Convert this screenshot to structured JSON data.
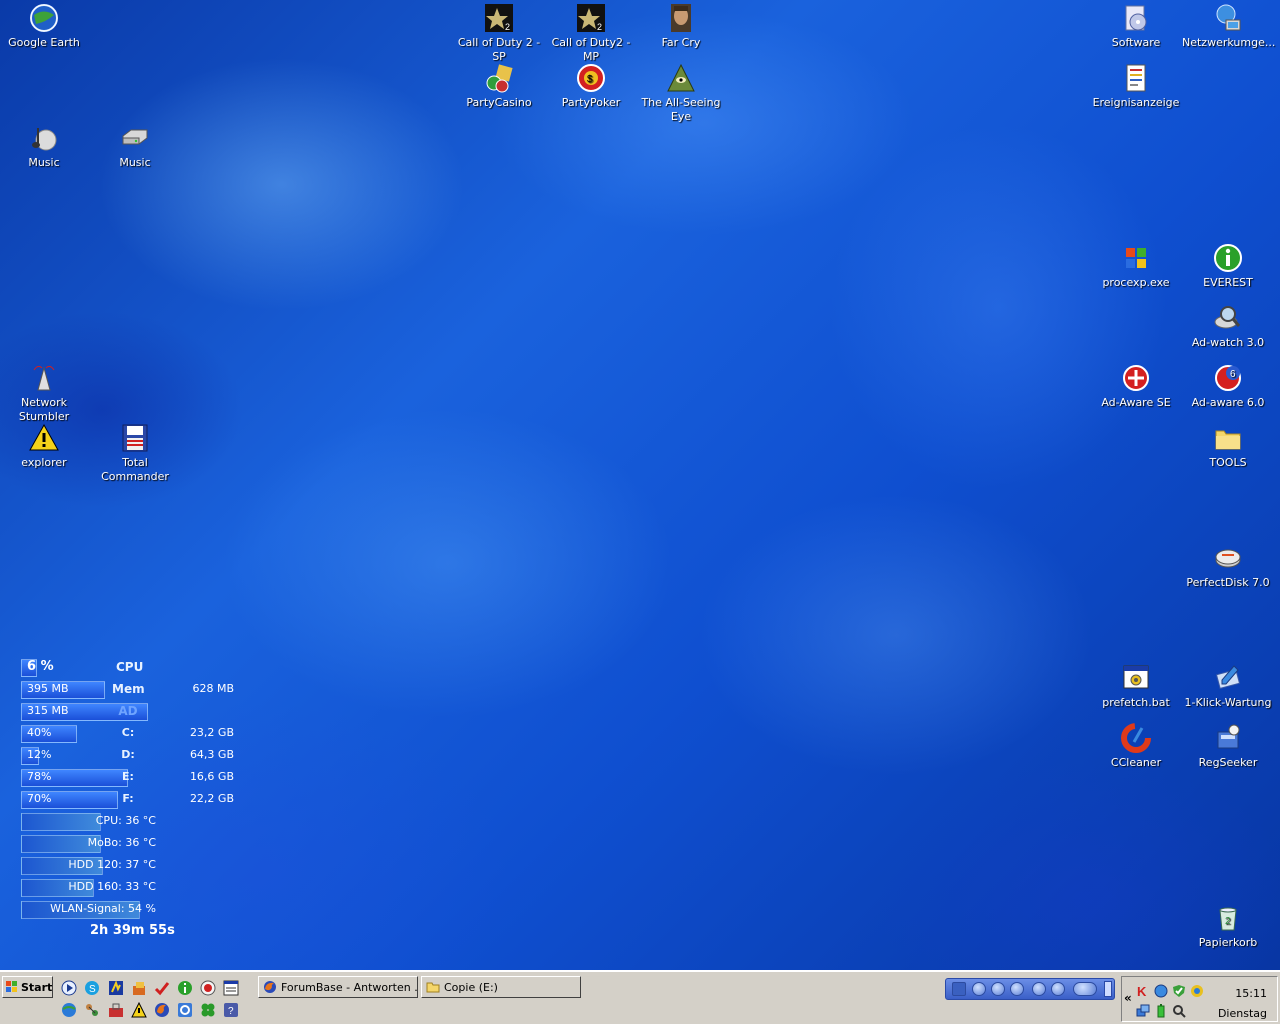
{
  "desktop_icons": {
    "google_earth": "Google Earth",
    "cod2_sp": "Call of Duty 2 - SP",
    "cod2_mp": "Call of Duty2 - MP",
    "far_cry": "Far Cry",
    "software": "Software",
    "netzwerk": "Netzwerkumge...",
    "partycasino": "PartyCasino",
    "partypoker": "PartyPoker",
    "allseeing_line1": "The All-Seeing",
    "allseeing_line2": "Eye",
    "ereignis": "Ereignisanzeige",
    "music1": "Music",
    "music2": "Music",
    "procexp": "procexp.exe",
    "everest": "EVEREST",
    "adwatch": "Ad-watch 3.0",
    "network_stumbler": "Network Stumbler",
    "adaware_se": "Ad-Aware SE",
    "adaware6": "Ad-aware 6.0",
    "explorer": "explorer",
    "total_commander": "Total Commander",
    "tools": "TOOLS",
    "perfectdisk": "PerfectDisk 7.0",
    "prefetch": "prefetch.bat",
    "klick": "1-Klick-Wartung",
    "ccleaner": "CCleaner",
    "regseeker": "RegSeeker",
    "papierkorb": "Papierkorb"
  },
  "monitor": {
    "cpu_value": "6 %",
    "cpu_tag": "CPU",
    "cpu_fraction": 0.06,
    "mem_value": "395 MB",
    "mem_tag": "Mem",
    "mem_total": "628 MB",
    "mem_fraction": 0.63,
    "ad_value": "315 MB",
    "ad_tag": "AD",
    "ad_fraction": 0.58,
    "drives": [
      {
        "pct": "40%",
        "tag": "C:",
        "free": "23,2 GB",
        "fraction": 0.4
      },
      {
        "pct": "12%",
        "tag": "D:",
        "free": "64,3 GB",
        "fraction": 0.12
      },
      {
        "pct": "78%",
        "tag": "E:",
        "free": "16,6 GB",
        "fraction": 0.78
      },
      {
        "pct": "70%",
        "tag": "F:",
        "free": "22,2 GB",
        "fraction": 0.7
      }
    ],
    "temps": [
      {
        "text": "CPU: 36 °C",
        "fraction": 0.36
      },
      {
        "text": "MoBo: 36 °C",
        "fraction": 0.36
      },
      {
        "text": "HDD 120: 37 °C",
        "fraction": 0.37
      },
      {
        "text": "HDD 160: 33 °C",
        "fraction": 0.33
      },
      {
        "text": "WLAN-Signal: 54 %",
        "fraction": 0.54
      }
    ],
    "uptime": "2h 39m 55s"
  },
  "taskbar": {
    "start_label": "Start",
    "windows": [
      {
        "label": "ForumBase - Antworten ..."
      },
      {
        "label": "Copie (E:)"
      }
    ],
    "tray_expand": "«",
    "clock_time": "15:11",
    "clock_day": "Dienstag"
  },
  "colors": {
    "desktop_blue": "#1a62dd",
    "taskbar_gray": "#d4d0c8"
  }
}
